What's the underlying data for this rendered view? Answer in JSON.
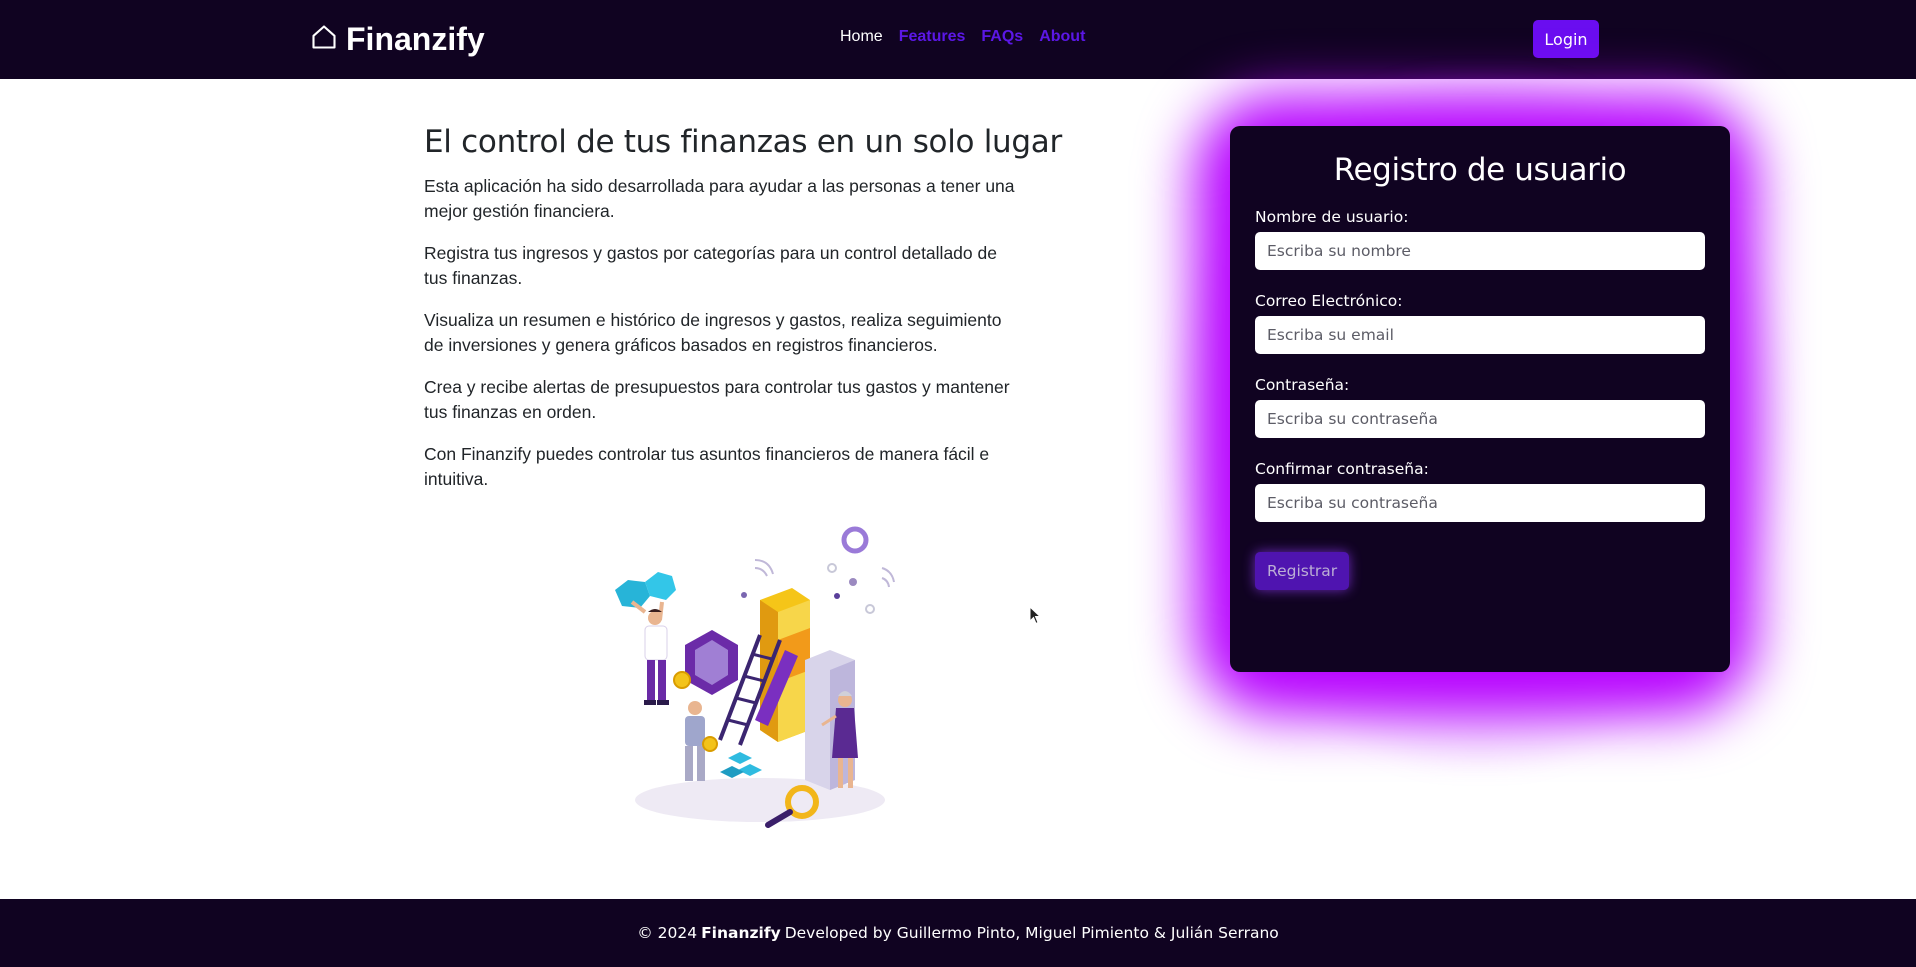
{
  "navbar": {
    "brand": "Finanzify",
    "brand_icon": "house-icon",
    "links": {
      "home": "Home",
      "features": "Features",
      "faqs": "FAQs",
      "about": "About"
    },
    "login_label": "Login",
    "colors": {
      "background": "#100321",
      "accent": "#6a0df0",
      "link": "#5b17e6"
    }
  },
  "hero": {
    "title": "El control de tus finanzas en un solo lugar",
    "paragraphs": [
      "Esta aplicación ha sido desarrollada para ayudar a las personas a tener una mejor gestión financiera.",
      "Registra tus ingresos y gastos por categorías para un control detallado de tus finanzas.",
      "Visualiza un resumen e histórico de ingresos y gastos, realiza seguimiento de inversiones y genera gráficos basados en registros financieros.",
      "Crea y recibe alertas de presupuestos para controlar tus gastos y mantener tus finanzas en orden.",
      "Con Finanzify puedes controlar tus asuntos financieros de manera fácil e intuitiva."
    ],
    "illustration_icon": "finance-team-illustration"
  },
  "register": {
    "title": "Registro de usuario",
    "username": {
      "label": "Nombre de usuario:",
      "placeholder": "Escriba su nombre"
    },
    "email": {
      "label": "Correo Electrónico:",
      "placeholder": "Escriba su email"
    },
    "password": {
      "label": "Contraseña:",
      "placeholder": "Escriba su contraseña"
    },
    "confirm_password": {
      "label": "Confirmar contraseña:",
      "placeholder": "Escriba su contraseña"
    },
    "submit_label": "Registrar",
    "glow_color": "#b600ff"
  },
  "footer": {
    "prefix": "© 2024",
    "brand": "Finanzify",
    "suffix": "Developed by Guillermo Pinto, Miguel Pimiento & Julián Serrano"
  }
}
